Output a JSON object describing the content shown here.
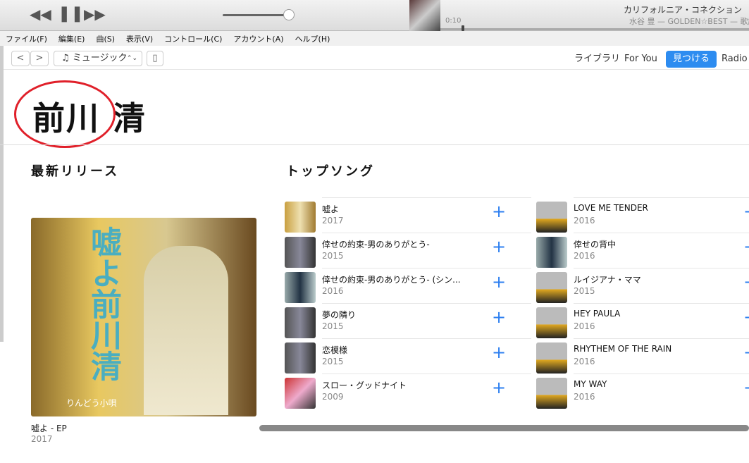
{
  "player": {
    "rewind": "◀◀",
    "pause": "❚❚",
    "forward": "▶▶",
    "time": "0:10",
    "title": "カリフォルニア・コネクション",
    "subtitle": "水谷 豊 — GOLDEN☆BEST — 歌謡"
  },
  "menu": [
    "ファイル(F)",
    "編集(E)",
    "曲(S)",
    "表示(V)",
    "コントロール(C)",
    "アカウント(A)",
    "ヘルプ(H)"
  ],
  "nav": {
    "back": "<",
    "forward": ">",
    "source": "♫ ミュージック",
    "source_arrow": "⌃⌄",
    "device": "▯",
    "tabs": [
      "ライブラリ",
      "For You",
      "見つける",
      "Radio"
    ]
  },
  "artist": "前川 清",
  "latest": {
    "heading": "最新リリース",
    "album_title": "嘘よ - EP",
    "album_year": "2017",
    "art_title": "嘘よ前川清",
    "art_sub": "りんどう小唄"
  },
  "top_songs": {
    "heading": "トップソング",
    "songs": [
      {
        "title": "嘘よ",
        "year": "2017"
      },
      {
        "title": "倖せの約束-男のありがとう-",
        "year": "2015"
      },
      {
        "title": "倖せの約束-男のありがとう- (シン...",
        "year": "2016"
      },
      {
        "title": "夢の隣り",
        "year": "2015"
      },
      {
        "title": "恋模様",
        "year": "2015"
      },
      {
        "title": "スロー・グッドナイト",
        "year": "2009"
      },
      {
        "title": "LOVE ME TENDER",
        "year": "2016"
      },
      {
        "title": "倖せの背中",
        "year": "2016"
      },
      {
        "title": "ルイジアナ・ママ",
        "year": "2015"
      },
      {
        "title": "HEY PAULA",
        "year": "2016"
      },
      {
        "title": "RHYTHEM OF THE RAIN",
        "year": "2016"
      },
      {
        "title": "MY WAY",
        "year": "2016"
      }
    ],
    "add": "+"
  },
  "colors": {
    "accent": "#2d8cf0",
    "highlight_circle": "#e0202a"
  }
}
